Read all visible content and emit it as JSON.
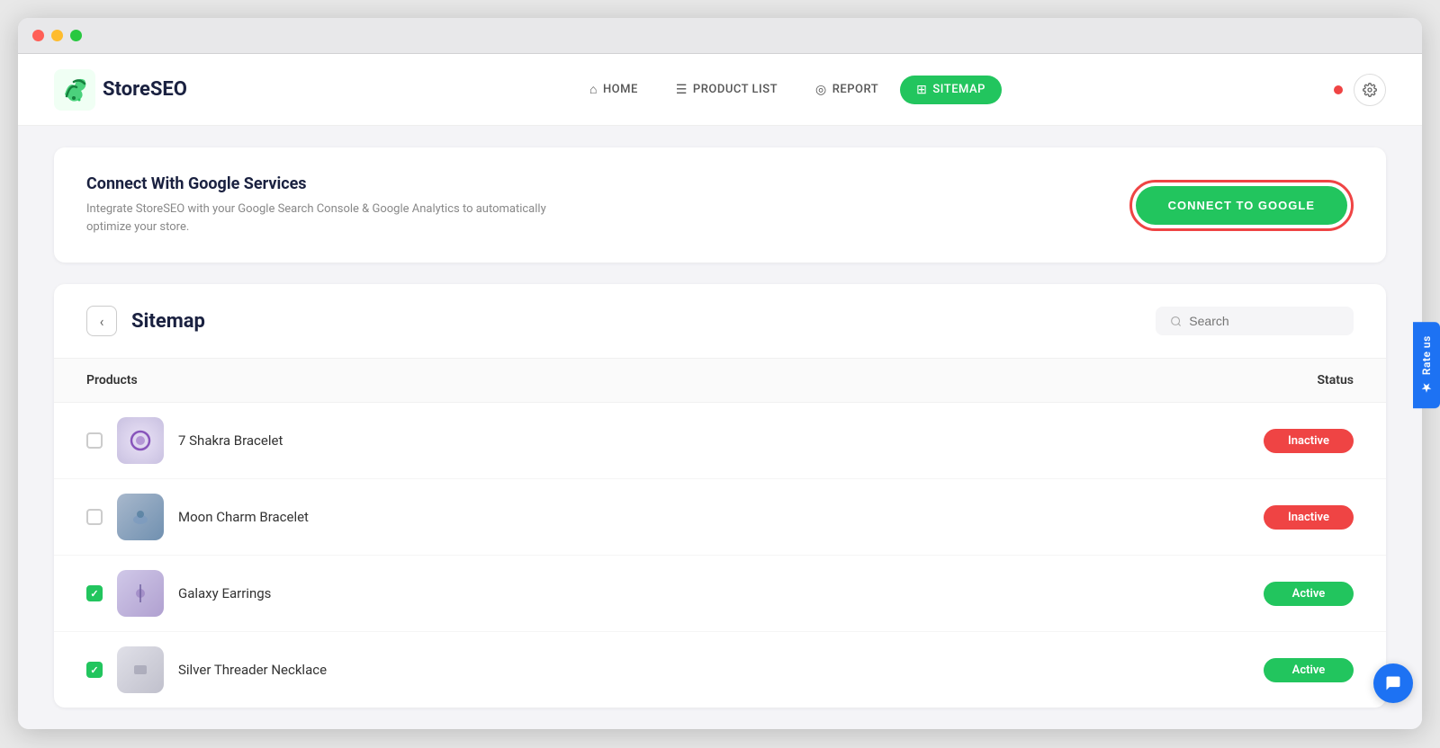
{
  "window": {
    "dots": [
      "red",
      "yellow",
      "green"
    ]
  },
  "header": {
    "logo_text": "StoreSEO",
    "nav_items": [
      {
        "id": "home",
        "label": "HOME",
        "icon": "⌂",
        "active": false
      },
      {
        "id": "product-list",
        "label": "PRODUCT LIST",
        "icon": "☰",
        "active": false
      },
      {
        "id": "report",
        "label": "REPORT",
        "icon": "◎",
        "active": false
      },
      {
        "id": "sitemap",
        "label": "SITEMAP",
        "icon": "⊞",
        "active": true
      }
    ]
  },
  "google_card": {
    "title": "Connect With Google Services",
    "description": "Integrate StoreSEO with your Google Search Console & Google Analytics to automatically optimize your store.",
    "button_label": "CONNECT TO GOOGLE"
  },
  "sitemap": {
    "title": "Sitemap",
    "back_label": "‹",
    "search_placeholder": "Search",
    "columns": {
      "products": "Products",
      "status": "Status"
    },
    "products": [
      {
        "id": 1,
        "name": "7 Shakra Bracelet",
        "checked": false,
        "status": "Inactive",
        "img_class": "product-img-1"
      },
      {
        "id": 2,
        "name": "Moon Charm Bracelet",
        "checked": false,
        "status": "Inactive",
        "img_class": "product-img-2"
      },
      {
        "id": 3,
        "name": "Galaxy Earrings",
        "checked": true,
        "status": "Active",
        "img_class": "product-img-3"
      },
      {
        "id": 4,
        "name": "Silver Threader Necklace",
        "checked": true,
        "status": "Active",
        "img_class": "product-img-4"
      }
    ]
  },
  "rate_us": {
    "label": "Rate us",
    "icon": "★"
  },
  "colors": {
    "active_green": "#22c55e",
    "inactive_red": "#ef4444",
    "accent_blue": "#1d72f3"
  }
}
